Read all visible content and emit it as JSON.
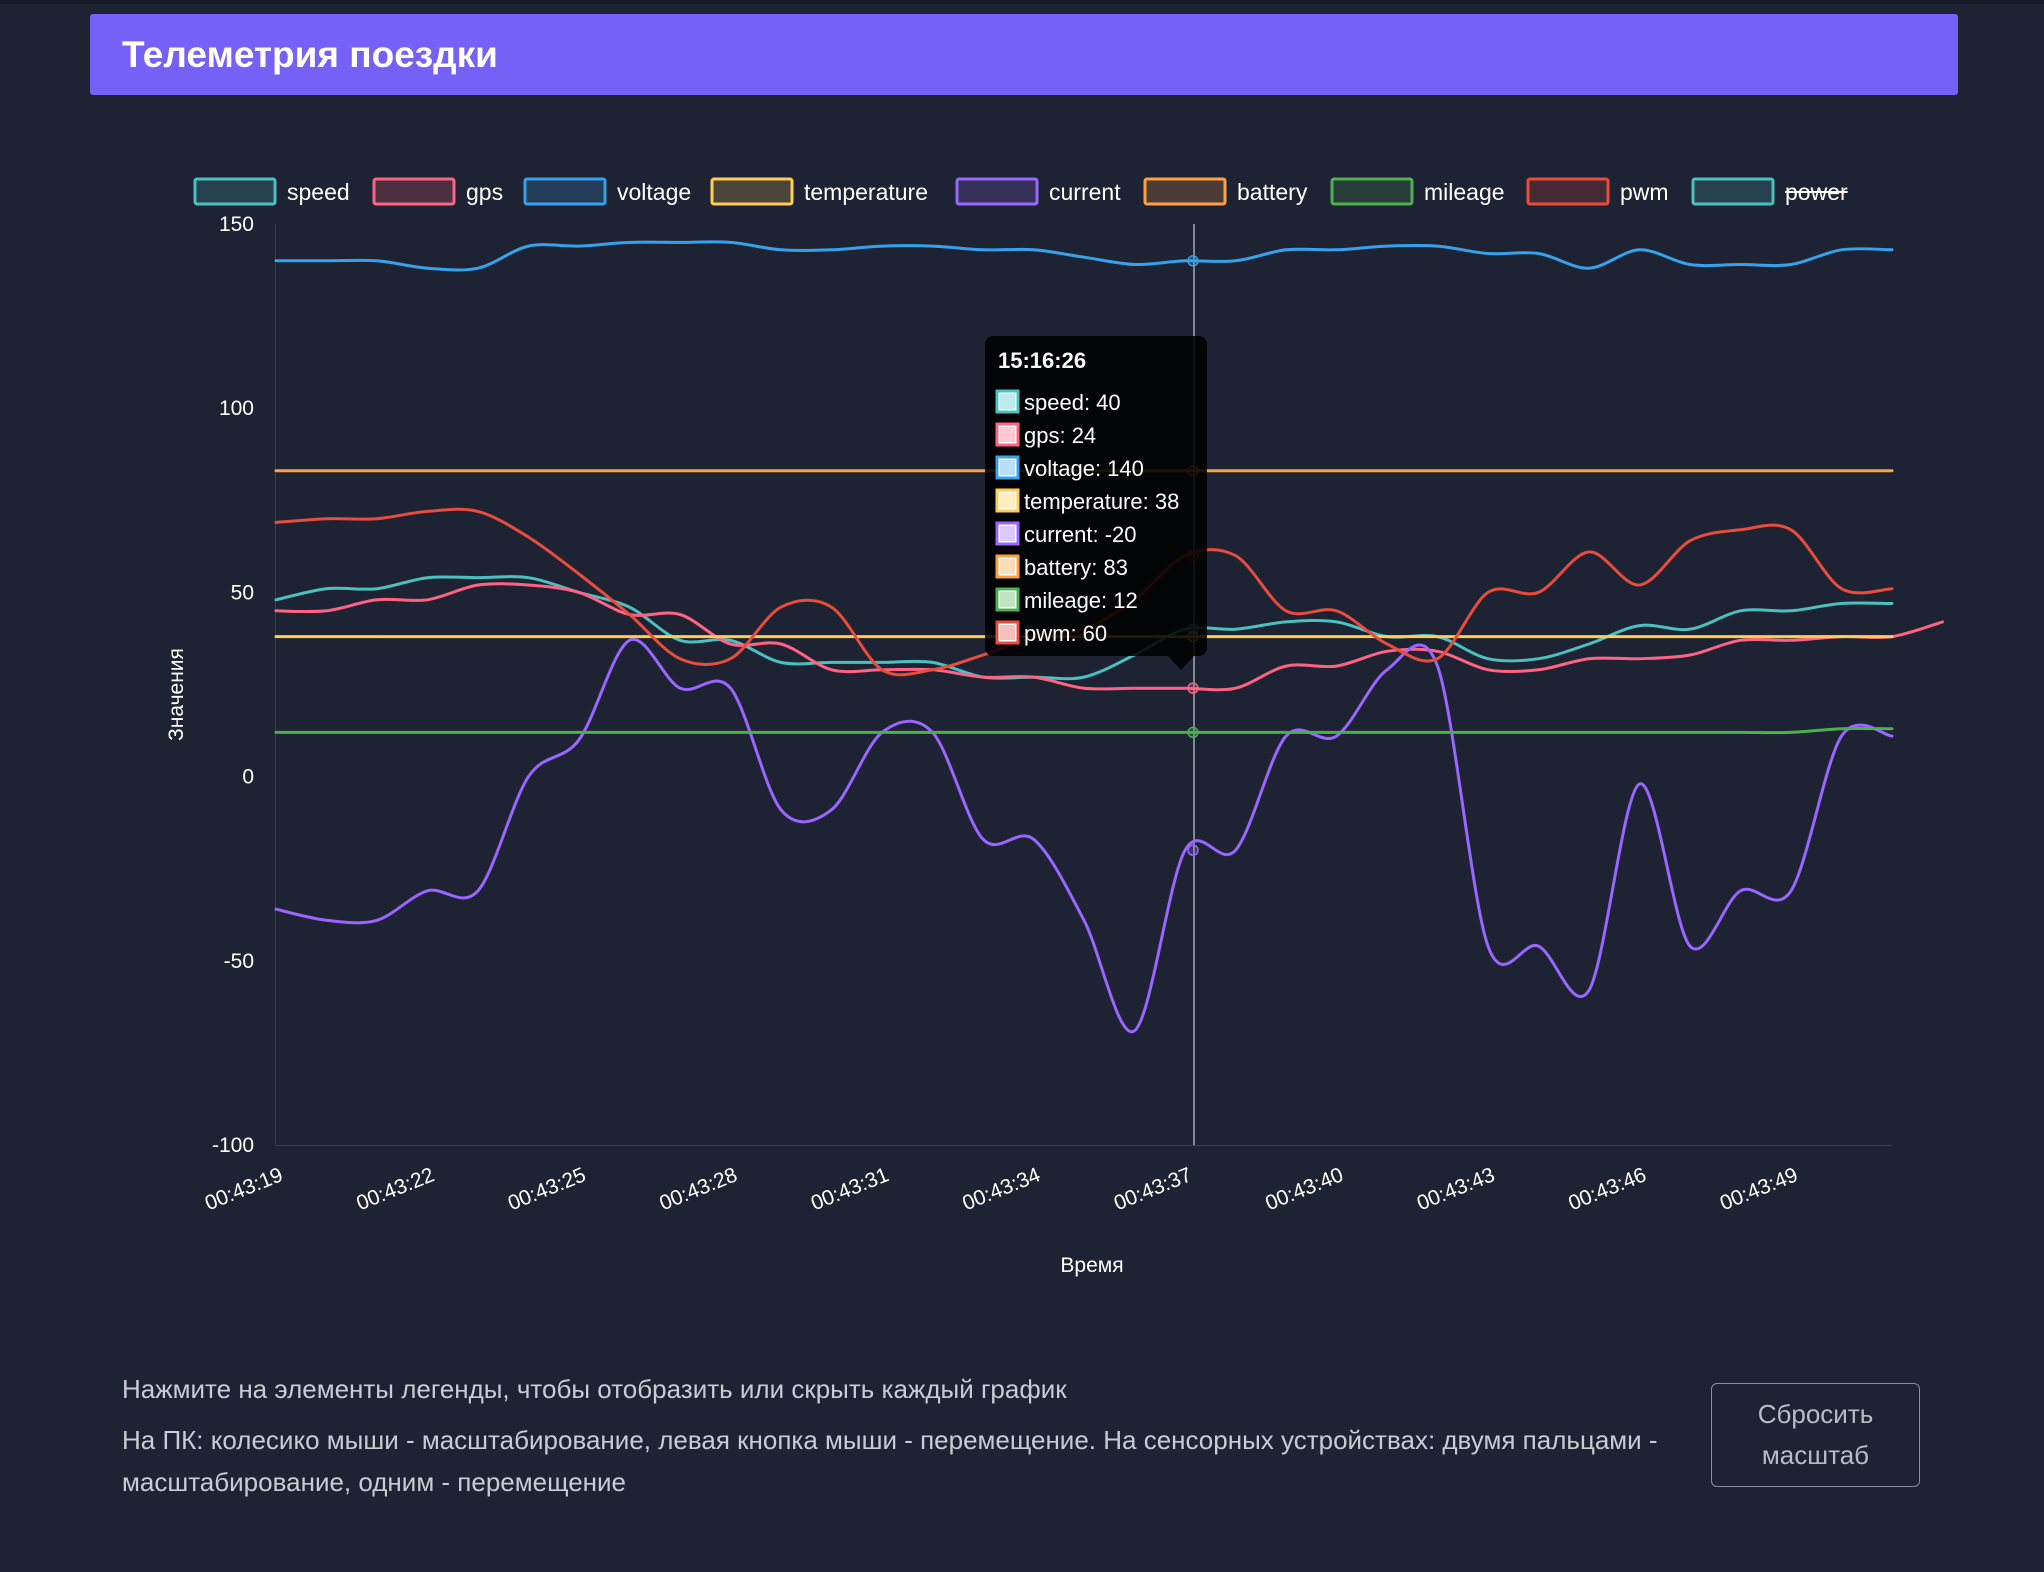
{
  "header": {
    "title": "Телеметрия поездки"
  },
  "hints": {
    "line1": "Нажмите на элементы легенды, чтобы отобразить или скрыть каждый график",
    "line2": "На ПК: колесико мыши - масштабирование, левая кнопка мыши - перемещение. На сенсорных устройствах: двумя пальцами - масштабирование, одним - перемещение"
  },
  "reset_button": {
    "label": "Сбросить масштаб"
  },
  "chart_data": {
    "type": "line",
    "xlabel": "Время",
    "ylabel": "Значения",
    "ylim": [
      -100,
      150
    ],
    "yticks": [
      "150",
      "100",
      "50",
      "0",
      "-50",
      "-100"
    ],
    "xticks": [
      "00:43:19",
      "00:43:22",
      "00:43:25",
      "00:43:28",
      "00:43:31",
      "00:43:34",
      "00:43:37",
      "00:43:40",
      "00:43:43",
      "00:43:46",
      "00:43:49"
    ],
    "xtick_indices": [
      0,
      3,
      6,
      9,
      12,
      15,
      18,
      21,
      24,
      27,
      30
    ],
    "n_points": 33,
    "grid": false,
    "legend_position": "top",
    "series": [
      {
        "name": "speed",
        "color": "#4bc0c0",
        "hidden": false,
        "values": [
          48,
          51,
          51,
          54,
          54,
          54,
          50,
          46,
          37,
          37,
          31,
          31,
          31,
          31,
          27,
          27,
          27,
          33,
          40,
          40,
          42,
          42,
          38,
          38,
          32,
          32,
          36,
          41,
          40,
          45,
          45,
          47,
          47
        ]
      },
      {
        "name": "gps",
        "color": "#ff6384",
        "hidden": false,
        "values": [
          45,
          45,
          48,
          48,
          52,
          52,
          50,
          44,
          44,
          36,
          36,
          29,
          29,
          29,
          27,
          27,
          24,
          24,
          24,
          24,
          30,
          30,
          34,
          34,
          29,
          29,
          32,
          32,
          33,
          37,
          37,
          38,
          38,
          42
        ]
      },
      {
        "name": "voltage",
        "color": "#36a2eb",
        "hidden": false,
        "values": [
          140,
          140,
          140,
          138,
          138,
          144,
          144,
          145,
          145,
          145,
          143,
          143,
          144,
          144,
          143,
          143,
          141,
          139,
          140,
          140,
          143,
          143,
          144,
          144,
          142,
          142,
          138,
          143,
          139,
          139,
          139,
          143,
          143
        ]
      },
      {
        "name": "temperature",
        "color": "#ffcd56",
        "hidden": false,
        "values": [
          38,
          38,
          38,
          38,
          38,
          38,
          38,
          38,
          38,
          38,
          38,
          38,
          38,
          38,
          38,
          38,
          38,
          38,
          38,
          38,
          38,
          38,
          38,
          38,
          38,
          38,
          38,
          38,
          38,
          38,
          38,
          38,
          38
        ]
      },
      {
        "name": "current",
        "color": "#9966ff",
        "hidden": false,
        "values": [
          -36,
          -39,
          -39,
          -31,
          -31,
          0,
          10,
          37,
          24,
          24,
          -9,
          -9,
          12,
          12,
          -17,
          -17,
          -39,
          -69,
          -20,
          -20,
          11,
          11,
          29,
          30,
          -46,
          -46,
          -58,
          -2,
          -46,
          -31,
          -31,
          11,
          11
        ]
      },
      {
        "name": "battery",
        "color": "#ff9f40",
        "hidden": false,
        "values": [
          83,
          83,
          83,
          83,
          83,
          83,
          83,
          83,
          83,
          83,
          83,
          83,
          83,
          83,
          83,
          83,
          83,
          83,
          83,
          83,
          83,
          83,
          83,
          83,
          83,
          83,
          83,
          83,
          83,
          83,
          83,
          83,
          83
        ]
      },
      {
        "name": "mileage",
        "color": "#4caf50",
        "hidden": false,
        "values": [
          12,
          12,
          12,
          12,
          12,
          12,
          12,
          12,
          12,
          12,
          12,
          12,
          12,
          12,
          12,
          12,
          12,
          12,
          12,
          12,
          12,
          12,
          12,
          12,
          12,
          12,
          12,
          12,
          12,
          12,
          12,
          13,
          13
        ]
      },
      {
        "name": "pwm",
        "color": "#e74c3c",
        "hidden": false,
        "values": [
          69,
          70,
          70,
          72,
          72,
          65,
          55,
          44,
          32,
          32,
          46,
          46,
          29,
          29,
          33,
          38,
          40,
          48,
          60,
          60,
          45,
          45,
          36,
          32,
          50,
          50,
          61,
          52,
          64,
          67,
          67,
          51,
          51
        ]
      },
      {
        "name": "power",
        "color": "#4bc0c0",
        "hidden": true,
        "values": []
      }
    ],
    "tooltip": {
      "title": "15:16:26",
      "index": 18,
      "items": [
        {
          "label": "speed: 40",
          "color": "#4bc0c0"
        },
        {
          "label": "gps: 24",
          "color": "#ff6384"
        },
        {
          "label": "voltage: 140",
          "color": "#36a2eb"
        },
        {
          "label": "temperature: 38",
          "color": "#ffcd56"
        },
        {
          "label": "current: -20",
          "color": "#9966ff"
        },
        {
          "label": "battery: 83",
          "color": "#ff9f40"
        },
        {
          "label": "mileage: 12",
          "color": "#4caf50"
        },
        {
          "label": "pwm: 60",
          "color": "#e74c3c"
        }
      ]
    }
  }
}
